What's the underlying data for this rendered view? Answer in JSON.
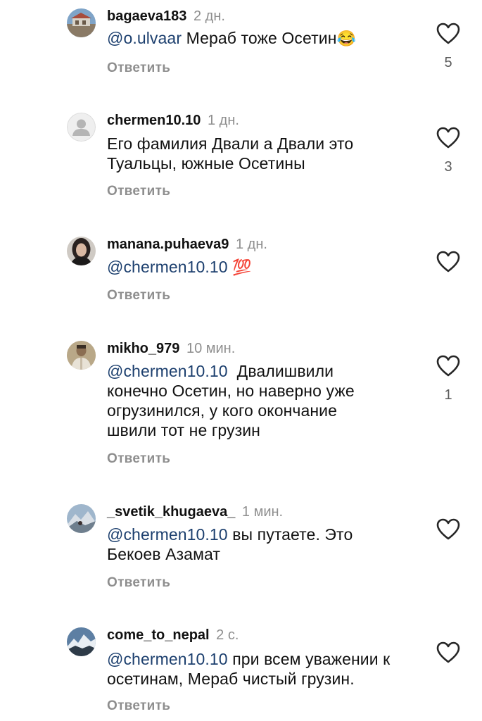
{
  "comments": [
    {
      "username": "bagaeva183",
      "time": "2 дн.",
      "mention": "@o.ulvaar",
      "text": " Мераб тоже Осетин",
      "emoji": "😂",
      "reply": "Ответить",
      "likes": "5"
    },
    {
      "username": "chermen10.10",
      "time": "1 дн.",
      "text_line1": "Его фамилия Двали а Двали это",
      "text_line2": "Туальцы, южные Осетины",
      "reply": "Ответить",
      "likes": "3"
    },
    {
      "username": "manana.puhaeva9",
      "time": "1 дн.",
      "mention": "@chermen10.10",
      "emoji": "💯",
      "reply": "Ответить"
    },
    {
      "username": "mikho_979",
      "time": "10 мин.",
      "mention": "@chermen10.10",
      "text_line1": "  Двалишвили",
      "text_line2": "конечно Осетин, но наверно уже",
      "text_line3": "огрузинился, у кого окончание",
      "text_line4": "швили тот не грузин",
      "reply": "Ответить",
      "likes": "1"
    },
    {
      "username": "_svetik_khugaeva_",
      "time": "1 мин.",
      "mention": "@chermen10.10",
      "text_line1": " вы путаете. Это",
      "text_line2": "Бекоев Азамат",
      "reply": "Ответить"
    },
    {
      "username": "come_to_nepal",
      "time": "2 с.",
      "mention": "@chermen10.10",
      "text_line1": " при всем уважении к",
      "text_line2": "осетинам, Мераб чистый грузин.",
      "reply": "Ответить"
    }
  ],
  "icons": {
    "like": "heart-outline-icon",
    "default_avatar": "default-user-avatar-icon"
  },
  "colors": {
    "mention": "#1c3f6e",
    "secondary_text": "#8e8e8e"
  }
}
